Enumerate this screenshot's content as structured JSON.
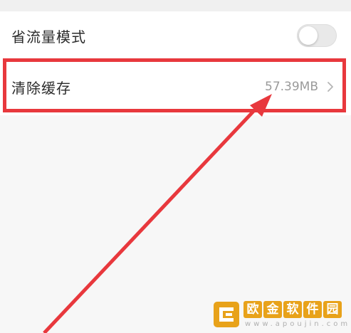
{
  "settings": {
    "data_saver": {
      "label": "省流量模式",
      "enabled": false
    },
    "clear_cache": {
      "label": "清除缓存",
      "value": "57.39MB"
    }
  },
  "annotation": {
    "color": "#e8383d"
  },
  "watermark": {
    "chars": [
      "欧",
      "金",
      "软",
      "件",
      "园"
    ],
    "url": "www.apoujin.com",
    "color": "#e8a21a"
  }
}
